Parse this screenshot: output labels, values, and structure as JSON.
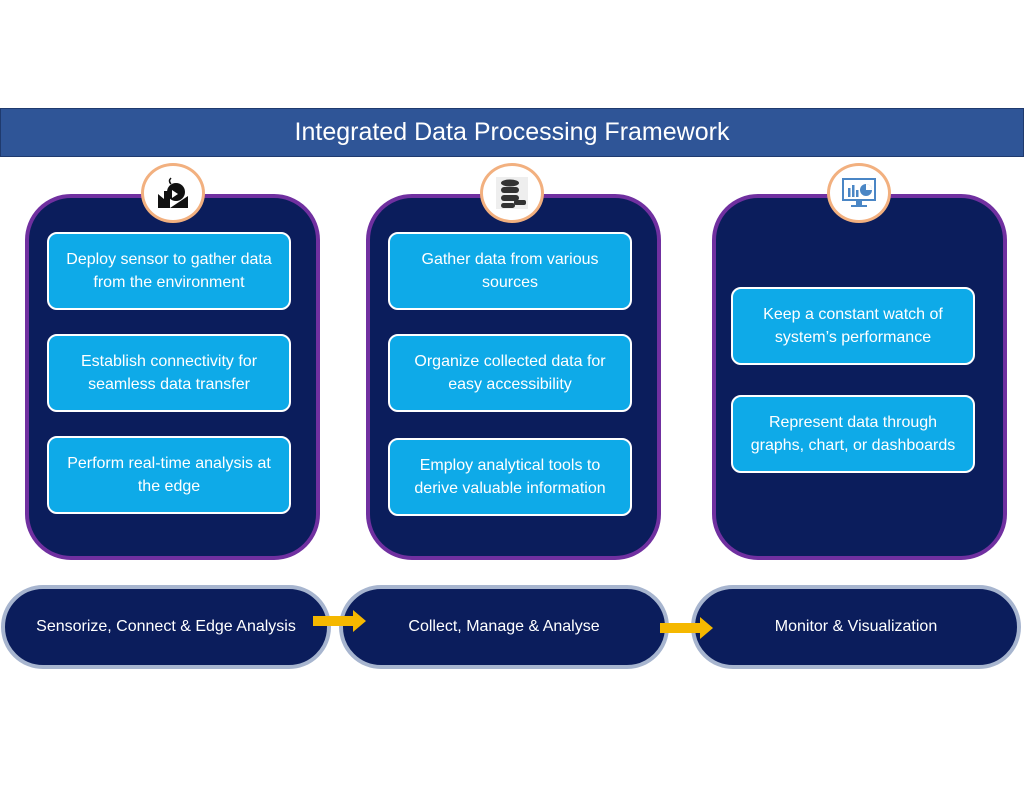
{
  "title": "Integrated Data Processing Framework",
  "colors": {
    "title_bar": "#2f5597",
    "panel_fill": "#0b1d5c",
    "panel_border": "#7030a0",
    "box_fill": "#0eaae8",
    "icon_ring": "#f2b07f",
    "arrow": "#f5b800"
  },
  "columns": [
    {
      "icon": "factory-gear-icon",
      "items": [
        "Deploy sensor to gather data from the environment",
        "Establish connectivity for seamless data transfer",
        "Perform real-time analysis at the edge"
      ],
      "stage": "Sensorize, Connect & Edge Analysis"
    },
    {
      "icon": "database-icon",
      "items": [
        "Gather data from various sources",
        "Organize collected data for easy accessibility",
        "Employ analytical tools to derive valuable information"
      ],
      "stage": "Collect, Manage & Analyse"
    },
    {
      "icon": "monitor-chart-icon",
      "items": [
        "Keep a constant watch of system’s performance",
        "Represent data through graphs, chart, or dashboards"
      ],
      "stage": "Monitor & Visualization"
    }
  ]
}
